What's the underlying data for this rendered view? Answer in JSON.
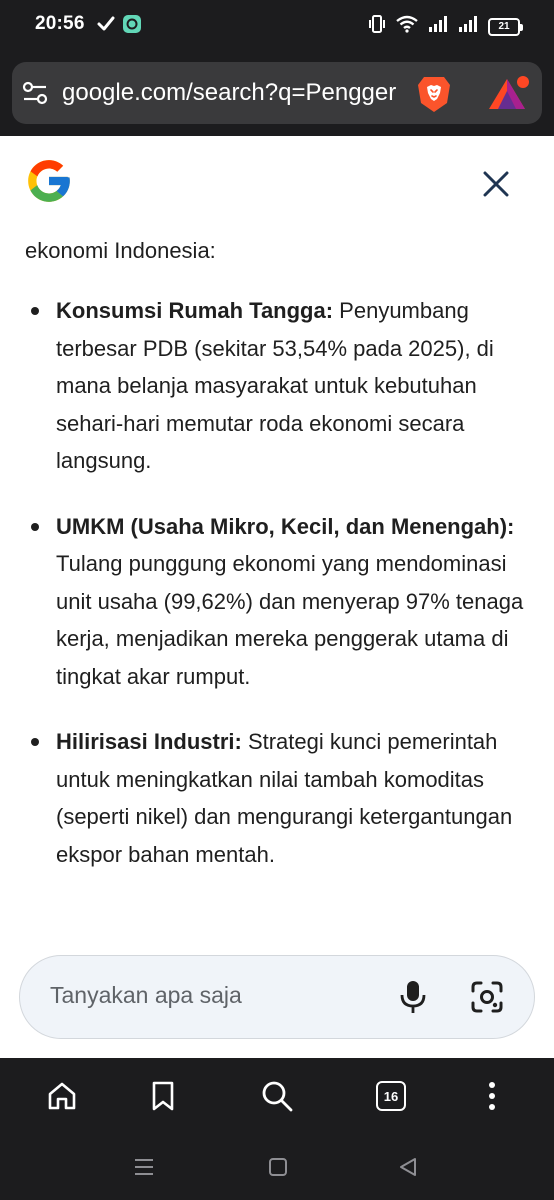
{
  "status_bar": {
    "time": "20:56",
    "battery": "21",
    "icons": [
      "check-icon",
      "chat-icon",
      "vibrate-icon",
      "wifi-icon",
      "signal-icon",
      "signal-icon",
      "battery-icon"
    ]
  },
  "browser": {
    "url": "google.com/search?q=Pengger"
  },
  "content": {
    "intro": "ekonomi Indonesia:",
    "bullets": [
      {
        "bold": "Konsumsi Rumah Tangga:",
        "text": " Penyumbang terbesar PDB (sekitar 53,54% pada 2025), di mana belanja masyarakat untuk kebutuhan sehari-hari memutar roda ekonomi secara langsung."
      },
      {
        "bold": "UMKM (Usaha Mikro, Kecil, dan Menengah):",
        "text": " Tulang punggung ekonomi yang mendominasi unit usaha (99,62%) dan menyerap 97% tenaga kerja, menjadikan mereka penggerak utama di tingkat akar rumput."
      },
      {
        "bold": "Hilirisasi Industri:",
        "text": " Strategi kunci pemerintah untuk meningkatkan nilai tambah komoditas (seperti nikel) dan mengurangi ketergantungan ekspor bahan mentah."
      }
    ]
  },
  "ask": {
    "placeholder": "Tanyakan apa saja"
  },
  "bottom_nav": {
    "tab_count": "16"
  },
  "colors": {
    "dark_chrome": "#1c1c1e",
    "url_box": "#3a3a3c",
    "ask_bar": "#f0f4f9",
    "text": "#1f1f1f"
  }
}
